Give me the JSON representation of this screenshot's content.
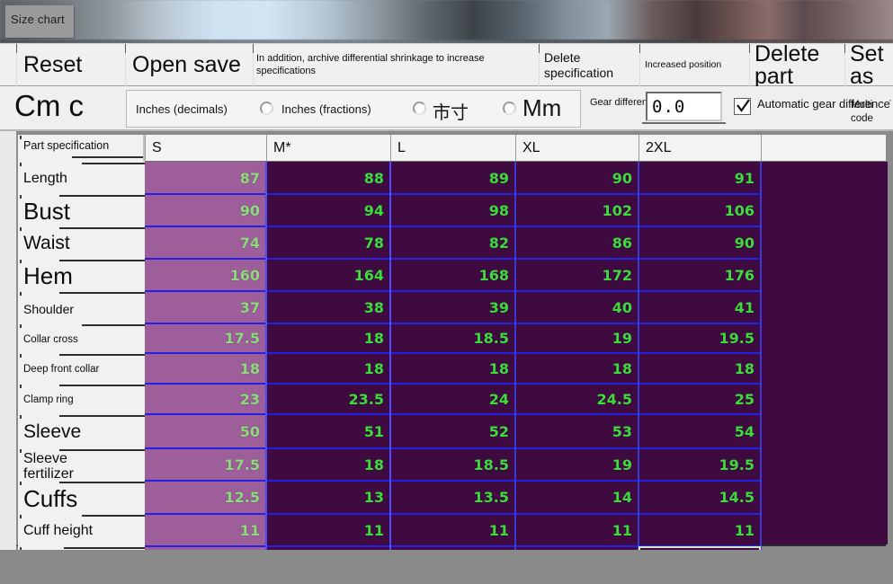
{
  "window": {
    "tab_label": "Size chart"
  },
  "toolbar": {
    "buttons": [
      {
        "label": "Reset",
        "size": "big"
      },
      {
        "label": "Open save",
        "size": "big"
      },
      {
        "label": "In addition, archive differential shrinkage to increase specifications",
        "size": "small"
      },
      {
        "label": "Delete specification",
        "size": "mid"
      },
      {
        "label": "Increased position",
        "size": "xsmall"
      },
      {
        "label": "Delete part",
        "size": "big"
      },
      {
        "label": "Set as",
        "size": "big"
      }
    ]
  },
  "units": {
    "cm_label": "Cm c",
    "options": [
      {
        "label": "Inches (decimals)",
        "selected": true,
        "has_radio": false
      },
      {
        "label": "Inches (fractions)",
        "selected": false,
        "has_radio": true
      },
      {
        "label": "市寸",
        "selected": false,
        "has_radio": true
      },
      {
        "label": "Mm",
        "selected": false,
        "has_radio": true
      }
    ]
  },
  "gear": {
    "label": "Gear difference",
    "value": "0.0",
    "auto_label": "Automatic gear difference",
    "auto_checked": true,
    "multi_code_label": "Multi code",
    "edge_label": "·"
  },
  "grid": {
    "corner_label": "Part specification",
    "columns": [
      "S",
      "M*",
      "L",
      "XL",
      "2XL",
      ""
    ],
    "selected_column": "M*",
    "rows": [
      {
        "label": "Length",
        "label_size": "m",
        "values": [
          "87",
          "88",
          "89",
          "90",
          "91"
        ]
      },
      {
        "label": "Bust",
        "label_size": "xl",
        "values": [
          "90",
          "94",
          "98",
          "102",
          "106"
        ]
      },
      {
        "label": "Waist",
        "label_size": "l",
        "values": [
          "74",
          "78",
          "82",
          "86",
          "90"
        ]
      },
      {
        "label": "Hem",
        "label_size": "xl",
        "values": [
          "160",
          "164",
          "168",
          "172",
          "176"
        ]
      },
      {
        "label": "Shoulder",
        "label_size": "s",
        "values": [
          "37",
          "38",
          "39",
          "40",
          "41"
        ]
      },
      {
        "label": "Collar cross",
        "label_size": "xs",
        "values": [
          "17.5",
          "18",
          "18.5",
          "19",
          "19.5"
        ]
      },
      {
        "label": "Deep front collar",
        "label_size": "xs",
        "values": [
          "18",
          "18",
          "18",
          "18",
          "18"
        ]
      },
      {
        "label": "Clamp ring",
        "label_size": "xs",
        "values": [
          "23",
          "23.5",
          "24",
          "24.5",
          "25"
        ]
      },
      {
        "label": "Sleeve",
        "label_size": "l",
        "values": [
          "50",
          "51",
          "52",
          "53",
          "54"
        ]
      },
      {
        "label": "Sleeve fertilizer",
        "label_size": "m",
        "values": [
          "17.5",
          "18",
          "18.5",
          "19",
          "19.5"
        ]
      },
      {
        "label": "Cuffs",
        "label_size": "xl",
        "values": [
          "12.5",
          "13",
          "13.5",
          "14",
          "14.5"
        ]
      },
      {
        "label": "Cuff height",
        "label_size": "m",
        "values": [
          "11",
          "11",
          "11",
          "11",
          "11"
        ]
      },
      {
        "label": "",
        "label_size": "m",
        "values": [
          "",
          "",
          "",
          "",
          ""
        ]
      }
    ],
    "active_cell": {
      "row_index": 12,
      "column_index": 5,
      "value": ""
    }
  },
  "colors": {
    "cell_bg": "#3e0a3f",
    "cell_selected_bg": "#9d5e99",
    "value_text": "#3ddb3d",
    "gridline": "#2222e6",
    "active_cell_border": "#cfe8c8",
    "chrome": "#efefef",
    "desktop": "#8a8a8a"
  }
}
